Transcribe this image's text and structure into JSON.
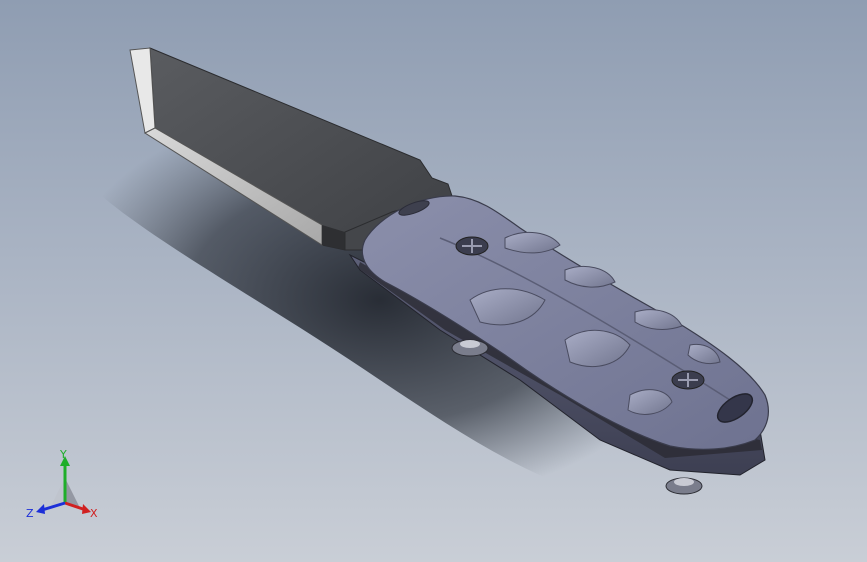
{
  "triad": {
    "x_label": "X",
    "y_label": "Y",
    "z_label": "Z",
    "colors": {
      "x": "#d02020",
      "y": "#1fae2a",
      "z": "#1c2fd8"
    }
  },
  "scene": {
    "model_icon": "knife-3d-model",
    "background_top": "#8f9db2",
    "background_bottom": "#c9ced6"
  }
}
